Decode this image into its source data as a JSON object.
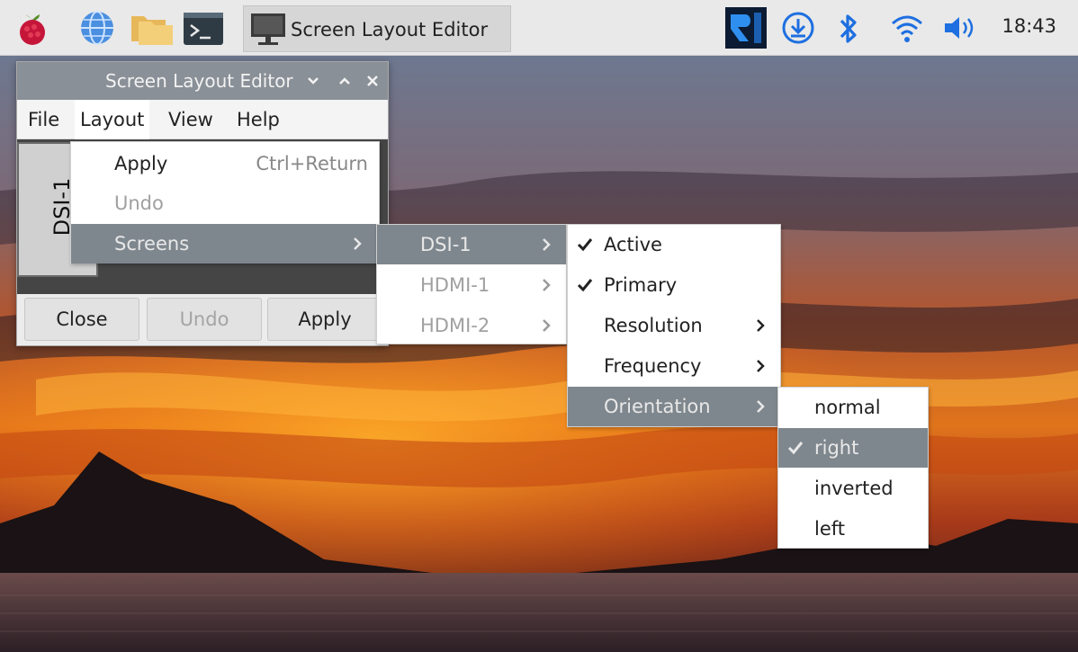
{
  "panel": {
    "taskbar_title": "Screen Layout Editor",
    "clock": "18:43",
    "icons": [
      "raspberry-menu-icon",
      "web-browser-icon",
      "file-manager-icon",
      "terminal-icon",
      "vnc-icon",
      "download-icon",
      "bluetooth-icon",
      "wifi-icon",
      "volume-icon"
    ]
  },
  "window": {
    "title": "Screen Layout Editor",
    "menubar": [
      "File",
      "Layout",
      "View",
      "Help"
    ],
    "screen_label": "DSI-1",
    "buttons": {
      "close": "Close",
      "undo": "Undo",
      "apply": "Apply"
    }
  },
  "layout_menu": {
    "apply": "Apply",
    "apply_accel": "Ctrl+Return",
    "undo": "Undo",
    "screens": "Screens"
  },
  "screens_menu": [
    "DSI-1",
    "HDMI-1",
    "HDMI-2"
  ],
  "dsi_menu": {
    "active": "Active",
    "primary": "Primary",
    "resolution": "Resolution",
    "frequency": "Frequency",
    "orientation": "Orientation"
  },
  "orientation_menu": {
    "options": [
      "normal",
      "right",
      "inverted",
      "left"
    ],
    "selected": "right"
  },
  "colors": {
    "panel_bg": "#e9e9e9",
    "highlight": "#7f878e",
    "titlebar": "#8a9097"
  }
}
